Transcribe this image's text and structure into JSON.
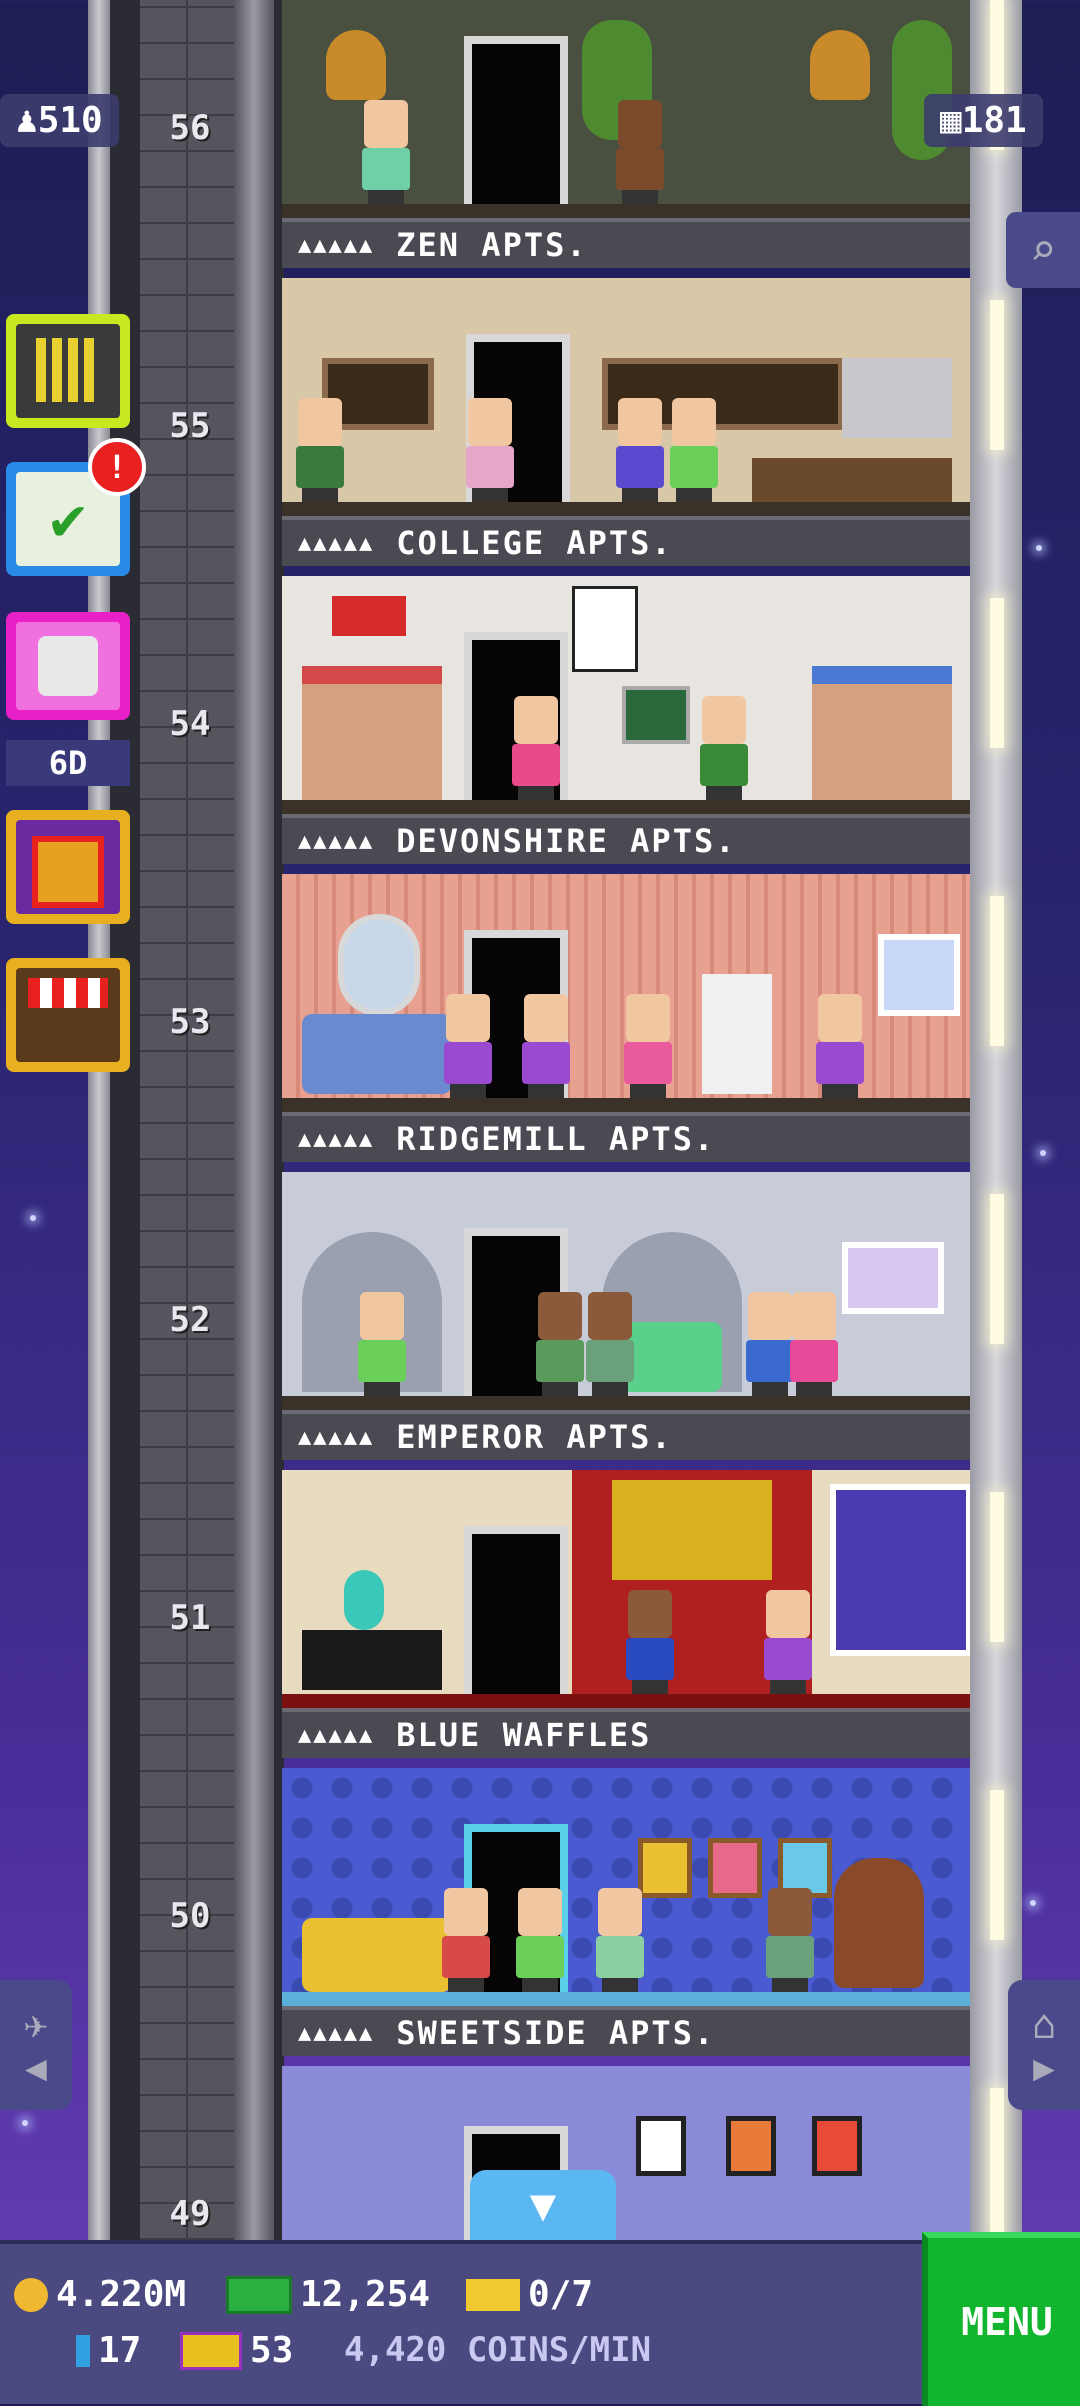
{
  "header": {
    "population": "510",
    "floors": "181"
  },
  "floors": [
    {
      "number": "56",
      "name": "ZEN APTS.",
      "dots": "▲▲▲▲▲"
    },
    {
      "number": "55",
      "name": "COLLEGE APTS.",
      "dots": "▲▲▲▲▲"
    },
    {
      "number": "54",
      "name": "DEVONSHIRE APTS.",
      "dots": "▲▲▲▲▲"
    },
    {
      "number": "53",
      "name": "RIDGEMILL APTS.",
      "dots": "▲▲▲▲▲"
    },
    {
      "number": "52",
      "name": "EMPEROR APTS.",
      "dots": "▲▲▲▲▲"
    },
    {
      "number": "51",
      "name": "BLUE WAFFLES",
      "dots": "▲▲▲▲▲"
    },
    {
      "number": "50",
      "name": "SWEETSIDE APTS.",
      "dots": "▲▲▲▲▲"
    },
    {
      "number": "49",
      "name": "",
      "dots": ""
    }
  ],
  "sidebar": {
    "dice_timer": "6D",
    "mission_alert": "!"
  },
  "bottom": {
    "coins": "4.220M",
    "bux": "12,254",
    "tickets": "0/7",
    "gems": "17",
    "vip": "53",
    "rate": "4,420 COINS/MIN",
    "menu_label": "MENU"
  },
  "colors": {
    "accent": "#12b52e",
    "bar": "#4a4980",
    "sky": "#2a2570"
  },
  "icons": [
    "person-icon",
    "floors-icon",
    "search-icon",
    "building-icon",
    "mission-icon",
    "dice-icon",
    "gift-icon",
    "shop-icon",
    "plane-icon",
    "home-icon",
    "coin-icon",
    "bux-icon",
    "ticket-icon",
    "gem-icon",
    "vip-icon",
    "down-arrow-icon"
  ]
}
